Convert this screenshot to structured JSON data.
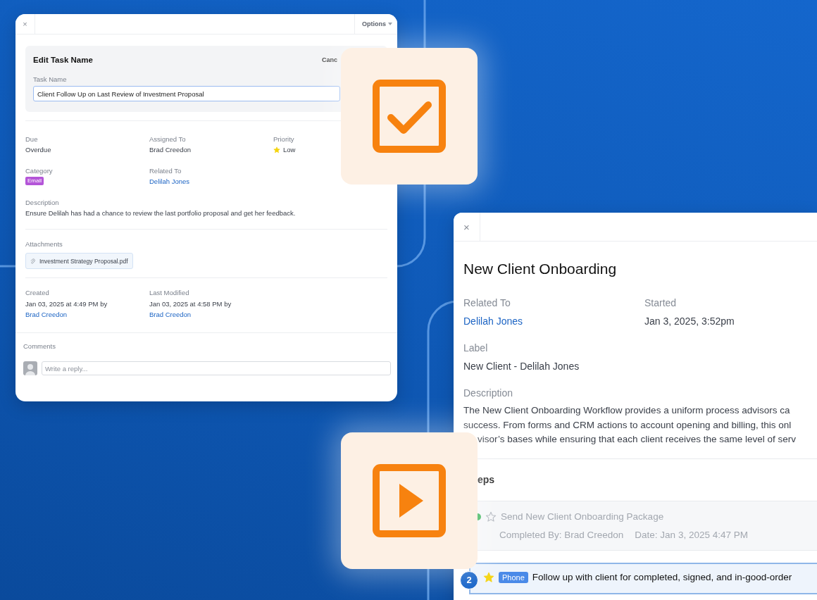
{
  "task_window": {
    "close": "×",
    "options": "Options",
    "edit_panel": {
      "title": "Edit Task Name",
      "cancel": "Canc",
      "field_label": "Task Name",
      "value": "Client Follow Up on Last Review of Investment Proposal"
    },
    "fields": [
      {
        "label": "Due",
        "kind": "text",
        "value": "Overdue"
      },
      {
        "label": "Assigned To",
        "kind": "text",
        "value": "Brad Creedon"
      },
      {
        "label": "Priority",
        "kind": "priority",
        "value": "Low"
      },
      {
        "label": "Category",
        "kind": "tag",
        "value": "Email"
      },
      {
        "label": "Related To",
        "kind": "link",
        "value": "Delilah Jones"
      }
    ],
    "description": {
      "label": "Description",
      "text": "Ensure Delilah has had a chance to review the last portfolio proposal and get her feedback."
    },
    "attachments": {
      "label": "Attachments",
      "files": [
        "Investment Strategy Proposal.pdf"
      ]
    },
    "history": [
      {
        "label": "Created",
        "text": "Jan 03, 2025 at 4:49 PM by",
        "user": "Brad Creedon"
      },
      {
        "label": "Last Modified",
        "text": "Jan 03, 2025 at 4:58 PM by",
        "user": "Brad Creedon"
      }
    ],
    "comments": {
      "label": "Comments",
      "placeholder": "Write a reply..."
    }
  },
  "workflow_window": {
    "close": "×",
    "title": "New Client Onboarding",
    "fields": [
      {
        "label": "Related To",
        "kind": "link",
        "value": "Delilah Jones"
      },
      {
        "label": "Started",
        "kind": "text",
        "value": "Jan 3, 2025, 3:52pm"
      },
      {
        "label": "Label",
        "kind": "text",
        "value": "New Client - Delilah Jones"
      }
    ],
    "description": {
      "label": "Description",
      "lines": [
        "The New Client Onboarding Workflow provides a uniform process advisors ca",
        "success. From forms and CRM actions to account opening and billing, this onl",
        "visor’s bases while ensuring that each client receives the same level of serv"
      ]
    },
    "steps_heading": "eps",
    "steps": [
      {
        "kind": "done",
        "starred": false,
        "active": false,
        "title": "Send New Client Onboarding Package",
        "completed_by": "Completed By: Brad Creedon",
        "date": "Date: Jan 3, 2025 4:47 PM"
      },
      {
        "kind": "open",
        "number": "2",
        "starred": true,
        "active": true,
        "tag": "Phone",
        "title": "Follow up with client for completed, signed, and in-good-order"
      }
    ]
  }
}
